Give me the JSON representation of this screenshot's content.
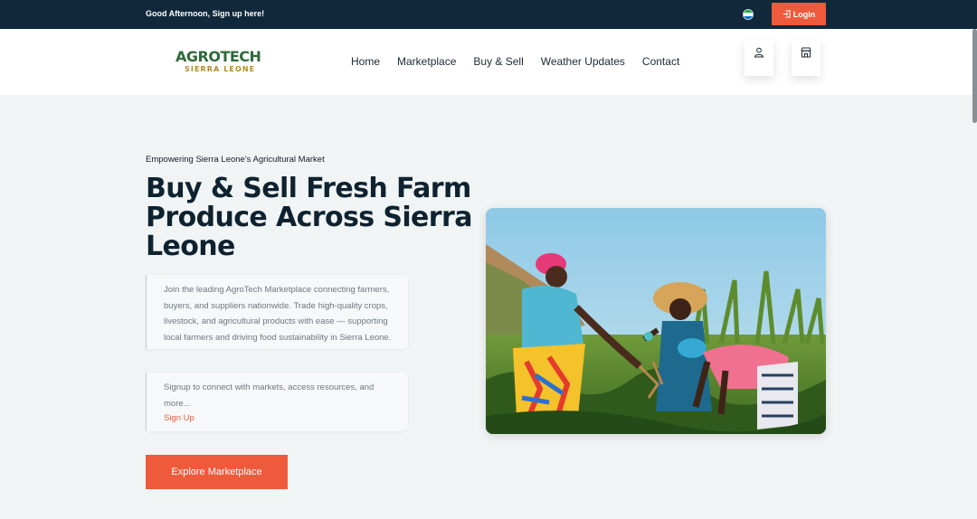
{
  "topbar": {
    "greeting": "Good Afternoon, Sign up here!",
    "flag": {
      "name": "sierra-leone-flag",
      "colors": [
        "#1eb53a",
        "#ffffff",
        "#0072c6"
      ]
    },
    "login_label": "Login",
    "login_icon": "login-icon"
  },
  "header": {
    "logo_main": "AGROTECH",
    "logo_sub": "SIERRA LEONE",
    "nav": [
      "Home",
      "Marketplace",
      "Buy & Sell",
      "Weather Updates",
      "Contact"
    ],
    "user_icon": "user-icon",
    "store_icon": "store-icon"
  },
  "hero": {
    "tagline": "Empowering Sierra Leone's Agricultural Market",
    "headline": "Buy & Sell Fresh Farm Produce Across Sierra Leone",
    "description": "Join the leading AgroTech Marketplace connecting farmers, buyers, and suppliers nationwide. Trade high-quality crops, livestock, and agricultural products with ease — supporting local farmers and driving food sustainability in Sierra Leone.",
    "signup_text": "Signup to connect with markets, access resources, and more...",
    "signup_link": "Sign Up",
    "cta_label": "Explore Marketplace",
    "image": "farmers-in-field-photo"
  },
  "colors": {
    "topbar_bg": "#11283a",
    "accent": "#f05a3c",
    "page_bg": "#f1f4f4",
    "logo_green": "#2f6a3a",
    "logo_gold": "#b08a2e"
  }
}
